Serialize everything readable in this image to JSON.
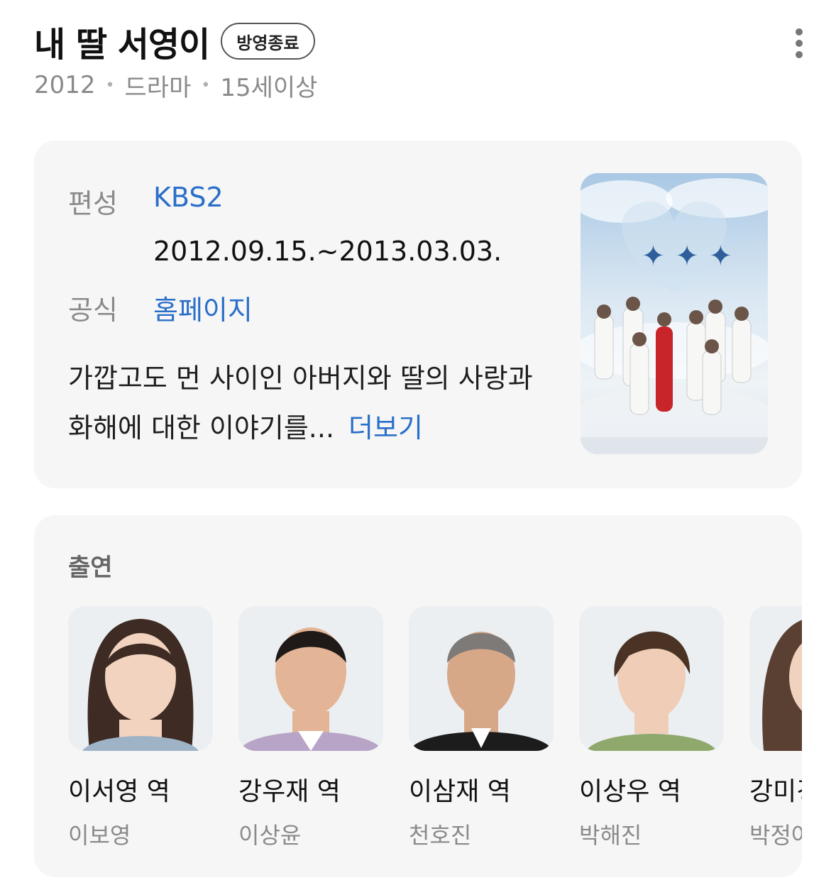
{
  "header": {
    "title": "내 딸 서영이",
    "status_badge": "방영종료",
    "meta": [
      "2012",
      "드라마",
      "15세이상"
    ]
  },
  "info": {
    "channel_label": "편성",
    "channel_value": "KBS2",
    "airing_period": "2012.09.15.~2013.03.03.",
    "official_label": "공식",
    "official_value": "홈페이지",
    "description": "가깝고도 먼 사이인 아버지와 딸의 사랑과 화해에 대한 이야기를...",
    "more_label": "더보기"
  },
  "cast": {
    "heading": "출연",
    "items": [
      {
        "role": "이서영 역",
        "actor": "이보영"
      },
      {
        "role": "강우재 역",
        "actor": "이상윤"
      },
      {
        "role": "이삼재 역",
        "actor": "천호진"
      },
      {
        "role": "이상우 역",
        "actor": "박해진"
      },
      {
        "role": "강미경 역",
        "actor": "박정아"
      }
    ]
  },
  "icons": {
    "more_menu": "vertical-ellipsis-icon"
  },
  "colors": {
    "link": "#2a6fc9",
    "card_bg": "#f6f6f6",
    "muted_text": "#8a8a8a"
  }
}
